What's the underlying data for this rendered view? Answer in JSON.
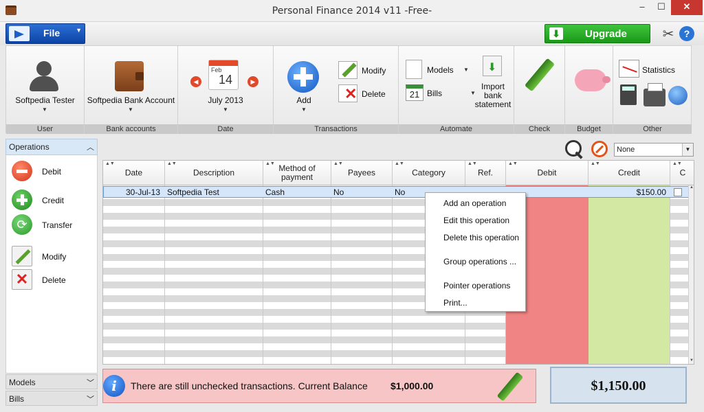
{
  "window": {
    "title": "Personal Finance 2014 v11 -Free-",
    "min_glyph": "–",
    "max_glyph": "☐",
    "close_glyph": "✕"
  },
  "menu": {
    "file_label": "File",
    "upgrade_label": "Upgrade"
  },
  "ribbon": {
    "user": {
      "name": "Softpedia Tester",
      "group": "User"
    },
    "bank": {
      "name": "Softpedia Bank Account",
      "group": "Bank accounts"
    },
    "date": {
      "month_abbrev": "Feb",
      "day": "14",
      "label": "July 2013",
      "group": "Date"
    },
    "transactions": {
      "add": "Add",
      "modify": "Modify",
      "delete": "Delete",
      "group": "Transactions"
    },
    "automate": {
      "models": "Models",
      "bills": "Bills",
      "bills_day": "21",
      "import_line1": "Import",
      "import_line2": "bank",
      "import_line3": "statement",
      "group": "Automate"
    },
    "check": {
      "group": "Check"
    },
    "budget": {
      "group": "Budget"
    },
    "other": {
      "statistics": "Statistics",
      "group": "Other"
    }
  },
  "left_panel": {
    "operations_title": "Operations",
    "items": [
      "Debit",
      "Credit",
      "Transfer",
      "Modify",
      "Delete"
    ],
    "models": "Models",
    "bills": "Bills"
  },
  "filter": {
    "selected": "None"
  },
  "grid": {
    "columns": [
      "Date",
      "Description",
      "Method of payment",
      "Payees",
      "Category",
      "Ref.",
      "Debit",
      "Credit",
      "C"
    ],
    "rows": [
      {
        "date": "30-Jul-13",
        "description": "Softpedia Test",
        "method": "Cash",
        "payees": "No",
        "category": "No",
        "ref": "",
        "debit": "",
        "credit": "$150.00",
        "checked": false
      }
    ]
  },
  "context_menu": [
    "Add an operation",
    "Edit this operation",
    "Delete this operation",
    "Group operations ...",
    "Pointer operations",
    "Print..."
  ],
  "status": {
    "message": "There are still unchecked transactions. Current Balance",
    "balance": "$1,000.00"
  },
  "total_balance": "$1,150.00",
  "colors": {
    "debit_column": "#f08383",
    "credit_column": "#d3e9a3",
    "status_bg": "#f7c5c5",
    "accent": "#1256c0",
    "upgrade": "#1a9a18"
  }
}
